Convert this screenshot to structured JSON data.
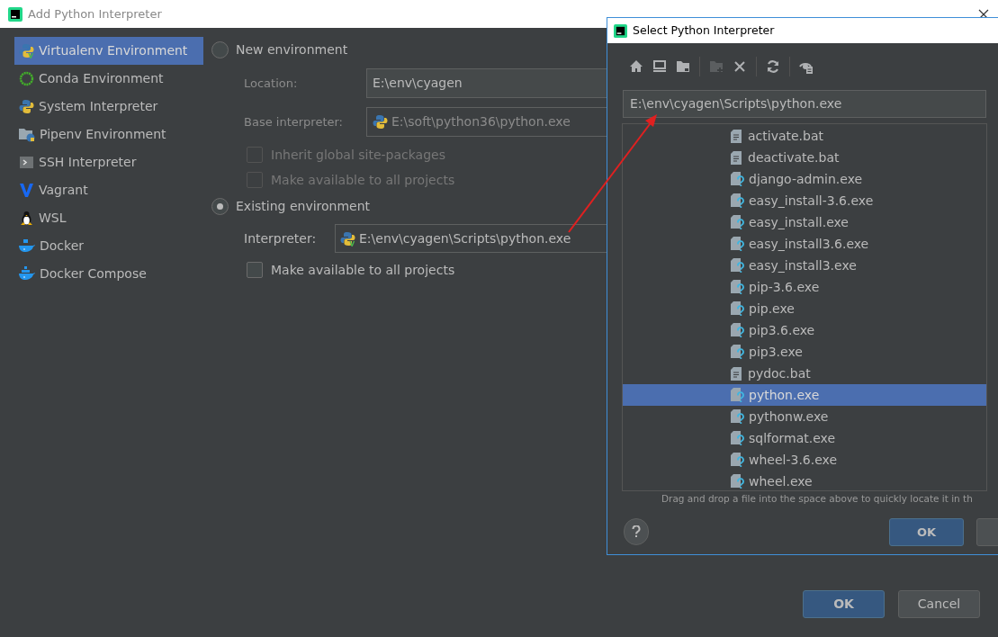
{
  "window": {
    "title": "Add Python Interpreter"
  },
  "sidebar": {
    "items": [
      {
        "label": "Virtualenv Environment",
        "selected": true
      },
      {
        "label": "Conda Environment",
        "selected": false
      },
      {
        "label": "System Interpreter",
        "selected": false
      },
      {
        "label": "Pipenv Environment",
        "selected": false
      },
      {
        "label": "SSH Interpreter",
        "selected": false
      },
      {
        "label": "Vagrant",
        "selected": false
      },
      {
        "label": "WSL",
        "selected": false
      },
      {
        "label": "Docker",
        "selected": false
      },
      {
        "label": "Docker Compose",
        "selected": false
      }
    ]
  },
  "new_environment": {
    "label": "New environment",
    "selected": false,
    "fields": [
      {
        "label": "Location:",
        "value": "E:\\env\\cyagen",
        "python_icon": false
      },
      {
        "label": "Base interpreter:",
        "value": "E:\\soft\\python36\\python.exe",
        "python_icon": true
      }
    ],
    "checkboxes": [
      {
        "label": "Inherit global site-packages",
        "checked": false
      },
      {
        "label": "Make available to all projects",
        "checked": false
      }
    ]
  },
  "existing_environment": {
    "label": "Existing environment",
    "selected": true,
    "interpreter": {
      "label": "Interpreter:",
      "value": "E:\\env\\cyagen\\Scripts\\python.exe"
    },
    "checkbox": {
      "label": "Make available to all projects",
      "checked": false
    }
  },
  "buttons": [
    {
      "label": "OK",
      "default": true
    },
    {
      "label": "Cancel",
      "default": false
    }
  ],
  "select_dialog": {
    "title": "Select Python Interpreter",
    "path": "E:\\env\\cyagen\\Scripts\\python.exe",
    "files": [
      {
        "name": "activate.bat",
        "kind": "text",
        "selected": false
      },
      {
        "name": "deactivate.bat",
        "kind": "text",
        "selected": false
      },
      {
        "name": "django-admin.exe",
        "kind": "unknown",
        "selected": false
      },
      {
        "name": "easy_install-3.6.exe",
        "kind": "unknown",
        "selected": false
      },
      {
        "name": "easy_install.exe",
        "kind": "unknown",
        "selected": false
      },
      {
        "name": "easy_install3.6.exe",
        "kind": "unknown",
        "selected": false
      },
      {
        "name": "easy_install3.exe",
        "kind": "unknown",
        "selected": false
      },
      {
        "name": "pip-3.6.exe",
        "kind": "unknown",
        "selected": false
      },
      {
        "name": "pip.exe",
        "kind": "unknown",
        "selected": false
      },
      {
        "name": "pip3.6.exe",
        "kind": "unknown",
        "selected": false
      },
      {
        "name": "pip3.exe",
        "kind": "unknown",
        "selected": false
      },
      {
        "name": "pydoc.bat",
        "kind": "text",
        "selected": false
      },
      {
        "name": "python.exe",
        "kind": "unknown",
        "selected": true
      },
      {
        "name": "pythonw.exe",
        "kind": "unknown",
        "selected": false
      },
      {
        "name": "sqlformat.exe",
        "kind": "unknown",
        "selected": false
      },
      {
        "name": "wheel-3.6.exe",
        "kind": "unknown",
        "selected": false
      },
      {
        "name": "wheel.exe",
        "kind": "unknown",
        "selected": false
      }
    ],
    "hint": "Drag and drop a file into the space above to quickly locate it in th",
    "ok_label": "OK"
  }
}
